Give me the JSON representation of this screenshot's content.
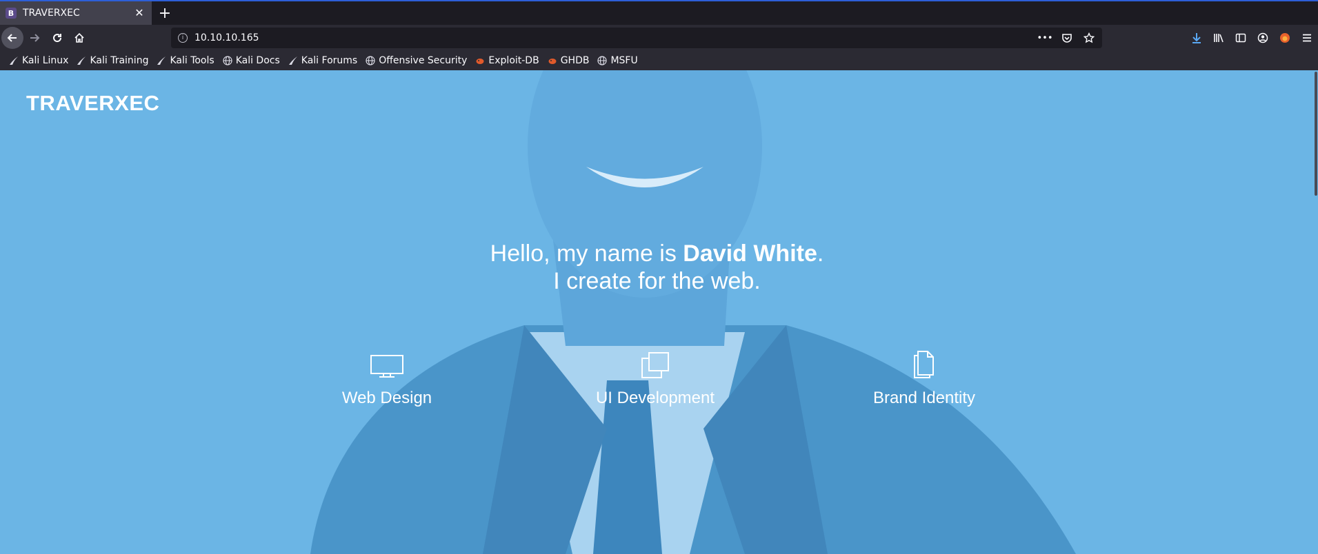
{
  "browser": {
    "tab": {
      "favicon_letter": "B",
      "title": "TRAVERXEC"
    },
    "url": "10.10.10.165",
    "bookmarks": [
      {
        "label": "Kali Linux",
        "icon": "kali-dragon-icon"
      },
      {
        "label": "Kali Training",
        "icon": "kali-dragon-icon"
      },
      {
        "label": "Kali Tools",
        "icon": "kali-dragon-icon"
      },
      {
        "label": "Kali Docs",
        "icon": "globe-icon"
      },
      {
        "label": "Kali Forums",
        "icon": "kali-dragon-icon"
      },
      {
        "label": "Offensive Security",
        "icon": "globe-icon"
      },
      {
        "label": "Exploit-DB",
        "icon": "exploitdb-icon"
      },
      {
        "label": "GHDB",
        "icon": "exploitdb-icon"
      },
      {
        "label": "MSFU",
        "icon": "globe-icon"
      }
    ]
  },
  "page": {
    "brand": "TRAVERXEC",
    "hero": {
      "greeting": "Hello, my name is ",
      "name": "David White",
      "period": ".",
      "tagline": "I create for the web."
    },
    "services": [
      {
        "label": "Web Design",
        "icon": "monitor-icon"
      },
      {
        "label": "UI Development",
        "icon": "stacked-windows-icon"
      },
      {
        "label": "Brand Identity",
        "icon": "documents-icon"
      }
    ],
    "colors": {
      "overlay": "#6bb5e5",
      "accent": "#2d5fd8"
    }
  }
}
